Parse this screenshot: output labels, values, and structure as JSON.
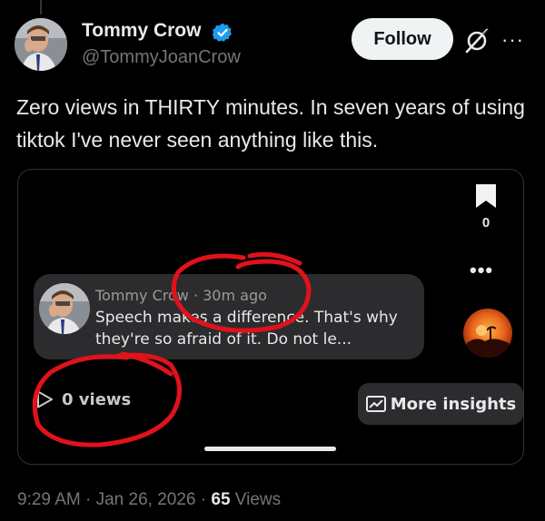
{
  "author": {
    "display_name": "Tommy Crow",
    "handle": "@TommyJoanCrow",
    "verified": true
  },
  "actions": {
    "follow_label": "Follow",
    "grok_icon": "grok-icon",
    "more_icon": "more-icon"
  },
  "post": {
    "text": "Zero views in THIRTY minutes. In seven years of using tiktok I've never seen anything like this."
  },
  "embed": {
    "bookmark_count": "0",
    "comment": {
      "author": "Tommy Crow",
      "age": "30m ago",
      "text": "Speech makes a difference. That's why they're so afraid of it. Do not le..."
    },
    "views_label": "0 views",
    "insights_label": "More insights"
  },
  "footer": {
    "time": "9:29 AM",
    "date": "Jan 26, 2026",
    "views_count": "65",
    "views_word": "Views"
  },
  "colors": {
    "verified_blue": "#1d9bf0",
    "annotation_red": "#e0121b",
    "secondary_text": "#71767b"
  }
}
